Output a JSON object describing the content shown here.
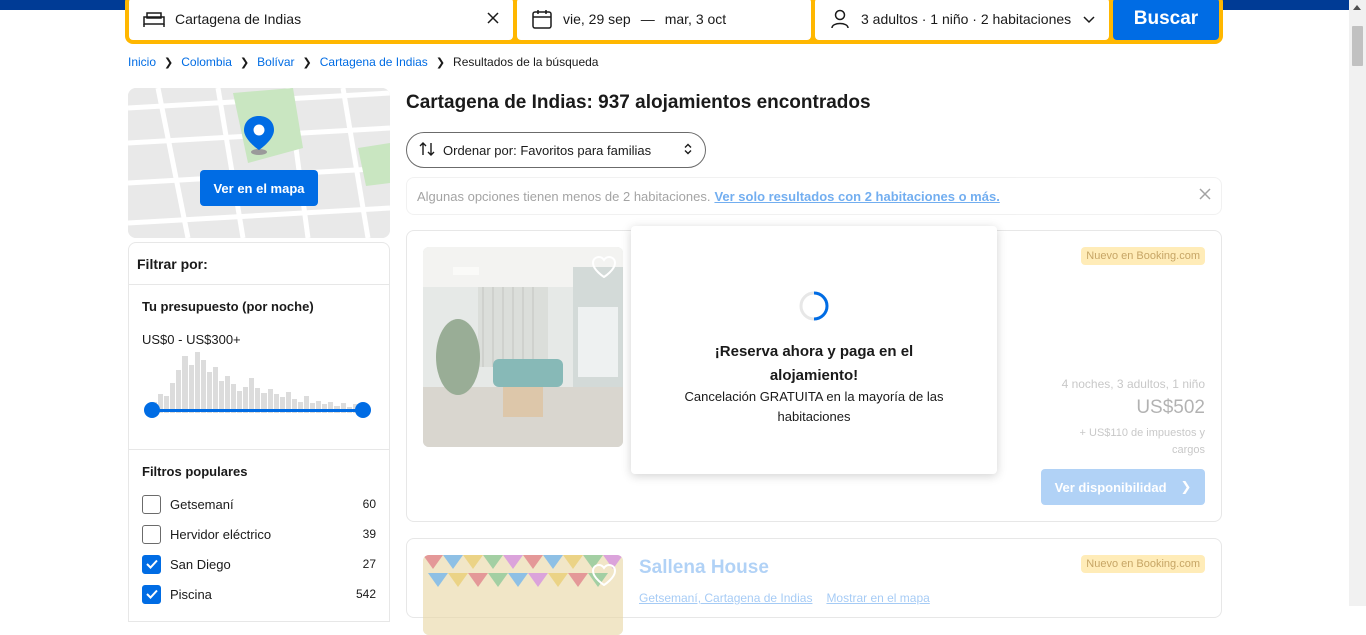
{
  "search": {
    "destination": "Cartagena de Indias",
    "checkin": "vie, 29 sep",
    "separator": "—",
    "checkout": "mar, 3 oct",
    "occupancy": "3 adultos · 1 niño · 2 habitaciones",
    "button": "Buscar"
  },
  "breadcrumb": [
    "Inicio",
    "Colombia",
    "Bolívar",
    "Cartagena de Indias",
    "Resultados de la búsqueda"
  ],
  "map": {
    "button": "Ver en el mapa"
  },
  "filters": {
    "title": "Filtrar por:",
    "budget": {
      "title": "Tu presupuesto (por noche)",
      "range": "US$0 - US$300+",
      "low": 0,
      "high": 1
    },
    "popular": {
      "title": "Filtros populares",
      "items": [
        {
          "label": "Getsemaní",
          "count": "60",
          "checked": false
        },
        {
          "label": "Hervidor eléctrico",
          "count": "39",
          "checked": false
        },
        {
          "label": "San Diego",
          "count": "27",
          "checked": true
        },
        {
          "label": "Piscina",
          "count": "542",
          "checked": true
        }
      ]
    }
  },
  "results": {
    "title": "Cartagena de Indias: 937 alojamientos encontrados",
    "sort": "Ordenar por: Favoritos para familias",
    "notice": {
      "text": "Algunas opciones tienen menos de 2 habitaciones.",
      "link": "Ver solo resultados con 2 habitaciones o más."
    },
    "cards": [
      {
        "name": "",
        "badge": "Nuevo en Booking.com",
        "stay": "4 noches, 3 adultos, 1 niño",
        "price": "US$502",
        "tax": "+ US$110 de impuestos y cargos",
        "button": "Ver disponibilidad"
      },
      {
        "name": "Sallena House",
        "badge": "Nuevo en Booking.com",
        "location": "Getsemaní, Cartagena de Indias",
        "map_link": "Mostrar en el mapa"
      }
    ]
  },
  "loader": {
    "title": "¡Reserva ahora y paga en el alojamiento!",
    "text": "Cancelación GRATUITA en la mayoría de las habitaciones"
  },
  "colors": {
    "brand_blue": "#003b95",
    "action_blue": "#006ce4",
    "search_yellow": "#ffb700"
  }
}
